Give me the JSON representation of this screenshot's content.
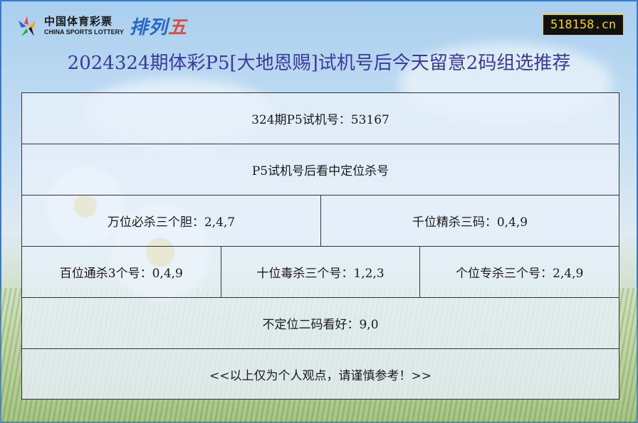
{
  "logo": {
    "cn": "中国体育彩票",
    "en": "CHINA SPORTS LOTTERY",
    "brand_a": "排列",
    "brand_b": "五"
  },
  "site_badge": "518158.cn",
  "headline": "2024324期体彩P5[大地恩赐]试机号后今天留意2码组选推荐",
  "rows": {
    "r1": "324期P5试机号：53167",
    "r2": "P5试机号后看中定位杀号",
    "r3": [
      "万位必杀三个胆：2,4,7",
      "千位精杀三码：0,4,9"
    ],
    "r4": [
      "百位通杀3个号：0,4,9",
      "十位毒杀三个号：1,2,3",
      "个位专杀三个号：2,4,9"
    ],
    "r5": "不定位二码看好：9,0",
    "r6": "<<以上仅为个人观点，请谨慎参考！>>"
  },
  "colors": {
    "frame": "#3a78c8",
    "headline": "#3a3a9a",
    "badge_bg": "#111111",
    "badge_text": "#f4d21c",
    "brand": "#2a66c8"
  }
}
